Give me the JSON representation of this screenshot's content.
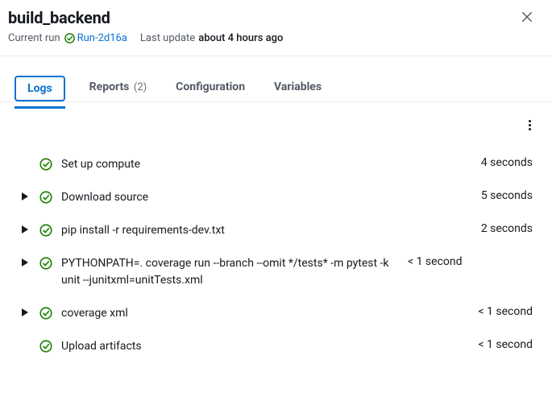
{
  "header": {
    "title": "build_backend",
    "current_run_label": "Current run",
    "run_id": "Run-2d16a",
    "last_update_label": "Last update",
    "last_update_value": "about 4 hours ago"
  },
  "tabs": {
    "logs": "Logs",
    "reports": "Reports",
    "reports_count": "(2)",
    "configuration": "Configuration",
    "variables": "Variables"
  },
  "logs": [
    {
      "expandable": false,
      "status": "success",
      "command": "Set up compute",
      "duration": "4 seconds"
    },
    {
      "expandable": true,
      "status": "success",
      "command": "Download source",
      "duration": "5 seconds"
    },
    {
      "expandable": true,
      "status": "success",
      "command": "pip install -r requirements-dev.txt",
      "duration": "2 seconds"
    },
    {
      "expandable": true,
      "status": "success",
      "command": "PYTHONPATH=. coverage run --branch --omit */tests* -m pytest -k unit --junitxml=unitTests.xml",
      "duration": "< 1 second"
    },
    {
      "expandable": true,
      "status": "success",
      "command": "coverage xml",
      "duration": "< 1 second"
    },
    {
      "expandable": false,
      "status": "success",
      "command": "Upload artifacts",
      "duration": "< 1 second"
    }
  ]
}
